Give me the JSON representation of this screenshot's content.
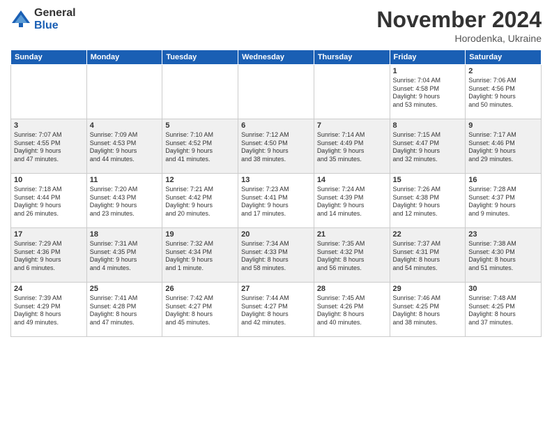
{
  "header": {
    "logo_general": "General",
    "logo_blue": "Blue",
    "month_title": "November 2024",
    "location": "Horodenka, Ukraine"
  },
  "weekdays": [
    "Sunday",
    "Monday",
    "Tuesday",
    "Wednesday",
    "Thursday",
    "Friday",
    "Saturday"
  ],
  "weeks": [
    [
      {
        "day": "",
        "info": ""
      },
      {
        "day": "",
        "info": ""
      },
      {
        "day": "",
        "info": ""
      },
      {
        "day": "",
        "info": ""
      },
      {
        "day": "",
        "info": ""
      },
      {
        "day": "1",
        "info": "Sunrise: 7:04 AM\nSunset: 4:58 PM\nDaylight: 9 hours\nand 53 minutes."
      },
      {
        "day": "2",
        "info": "Sunrise: 7:06 AM\nSunset: 4:56 PM\nDaylight: 9 hours\nand 50 minutes."
      }
    ],
    [
      {
        "day": "3",
        "info": "Sunrise: 7:07 AM\nSunset: 4:55 PM\nDaylight: 9 hours\nand 47 minutes."
      },
      {
        "day": "4",
        "info": "Sunrise: 7:09 AM\nSunset: 4:53 PM\nDaylight: 9 hours\nand 44 minutes."
      },
      {
        "day": "5",
        "info": "Sunrise: 7:10 AM\nSunset: 4:52 PM\nDaylight: 9 hours\nand 41 minutes."
      },
      {
        "day": "6",
        "info": "Sunrise: 7:12 AM\nSunset: 4:50 PM\nDaylight: 9 hours\nand 38 minutes."
      },
      {
        "day": "7",
        "info": "Sunrise: 7:14 AM\nSunset: 4:49 PM\nDaylight: 9 hours\nand 35 minutes."
      },
      {
        "day": "8",
        "info": "Sunrise: 7:15 AM\nSunset: 4:47 PM\nDaylight: 9 hours\nand 32 minutes."
      },
      {
        "day": "9",
        "info": "Sunrise: 7:17 AM\nSunset: 4:46 PM\nDaylight: 9 hours\nand 29 minutes."
      }
    ],
    [
      {
        "day": "10",
        "info": "Sunrise: 7:18 AM\nSunset: 4:44 PM\nDaylight: 9 hours\nand 26 minutes."
      },
      {
        "day": "11",
        "info": "Sunrise: 7:20 AM\nSunset: 4:43 PM\nDaylight: 9 hours\nand 23 minutes."
      },
      {
        "day": "12",
        "info": "Sunrise: 7:21 AM\nSunset: 4:42 PM\nDaylight: 9 hours\nand 20 minutes."
      },
      {
        "day": "13",
        "info": "Sunrise: 7:23 AM\nSunset: 4:41 PM\nDaylight: 9 hours\nand 17 minutes."
      },
      {
        "day": "14",
        "info": "Sunrise: 7:24 AM\nSunset: 4:39 PM\nDaylight: 9 hours\nand 14 minutes."
      },
      {
        "day": "15",
        "info": "Sunrise: 7:26 AM\nSunset: 4:38 PM\nDaylight: 9 hours\nand 12 minutes."
      },
      {
        "day": "16",
        "info": "Sunrise: 7:28 AM\nSunset: 4:37 PM\nDaylight: 9 hours\nand 9 minutes."
      }
    ],
    [
      {
        "day": "17",
        "info": "Sunrise: 7:29 AM\nSunset: 4:36 PM\nDaylight: 9 hours\nand 6 minutes."
      },
      {
        "day": "18",
        "info": "Sunrise: 7:31 AM\nSunset: 4:35 PM\nDaylight: 9 hours\nand 4 minutes."
      },
      {
        "day": "19",
        "info": "Sunrise: 7:32 AM\nSunset: 4:34 PM\nDaylight: 9 hours\nand 1 minute."
      },
      {
        "day": "20",
        "info": "Sunrise: 7:34 AM\nSunset: 4:33 PM\nDaylight: 8 hours\nand 58 minutes."
      },
      {
        "day": "21",
        "info": "Sunrise: 7:35 AM\nSunset: 4:32 PM\nDaylight: 8 hours\nand 56 minutes."
      },
      {
        "day": "22",
        "info": "Sunrise: 7:37 AM\nSunset: 4:31 PM\nDaylight: 8 hours\nand 54 minutes."
      },
      {
        "day": "23",
        "info": "Sunrise: 7:38 AM\nSunset: 4:30 PM\nDaylight: 8 hours\nand 51 minutes."
      }
    ],
    [
      {
        "day": "24",
        "info": "Sunrise: 7:39 AM\nSunset: 4:29 PM\nDaylight: 8 hours\nand 49 minutes."
      },
      {
        "day": "25",
        "info": "Sunrise: 7:41 AM\nSunset: 4:28 PM\nDaylight: 8 hours\nand 47 minutes."
      },
      {
        "day": "26",
        "info": "Sunrise: 7:42 AM\nSunset: 4:27 PM\nDaylight: 8 hours\nand 45 minutes."
      },
      {
        "day": "27",
        "info": "Sunrise: 7:44 AM\nSunset: 4:27 PM\nDaylight: 8 hours\nand 42 minutes."
      },
      {
        "day": "28",
        "info": "Sunrise: 7:45 AM\nSunset: 4:26 PM\nDaylight: 8 hours\nand 40 minutes."
      },
      {
        "day": "29",
        "info": "Sunrise: 7:46 AM\nSunset: 4:25 PM\nDaylight: 8 hours\nand 38 minutes."
      },
      {
        "day": "30",
        "info": "Sunrise: 7:48 AM\nSunset: 4:25 PM\nDaylight: 8 hours\nand 37 minutes."
      }
    ]
  ]
}
